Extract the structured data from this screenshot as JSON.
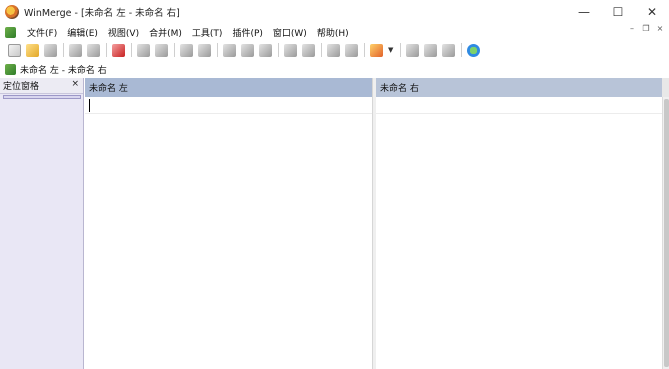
{
  "window": {
    "title": "WinMerge - [未命名 左 - 未命名 右]",
    "minimize_glyph": "—",
    "maximize_glyph": "☐",
    "close_glyph": "✕"
  },
  "menu": {
    "items": [
      "文件(F)",
      "编辑(E)",
      "视图(V)",
      "合并(M)",
      "工具(T)",
      "插件(P)",
      "窗口(W)",
      "帮助(H)"
    ],
    "mdi_minimize": "–",
    "mdi_restore": "❐",
    "mdi_close": "×"
  },
  "toolbar": {
    "icons": [
      "new-document-icon",
      "open-folder-icon",
      "save-icon",
      "undo-icon",
      "redo-icon",
      "highlight-icon",
      "next-diff-icon",
      "prev-diff-icon",
      "first-diff-icon",
      "last-diff-icon",
      "current-diff-icon",
      "copy-to-right-icon",
      "copy-to-left-icon",
      "copy-right-advance-icon",
      "copy-left-advance-icon",
      "all-right-icon",
      "all-left-icon",
      "options-icon",
      "refresh-icon"
    ],
    "dropdown_glyph": "▼"
  },
  "doc_tab": {
    "label": "未命名 左 - 未命名 右"
  },
  "location_pane": {
    "title": "定位窗格",
    "close_glyph": "×"
  },
  "left_pane": {
    "header": "未命名 左"
  },
  "right_pane": {
    "header": "未命名 右"
  }
}
